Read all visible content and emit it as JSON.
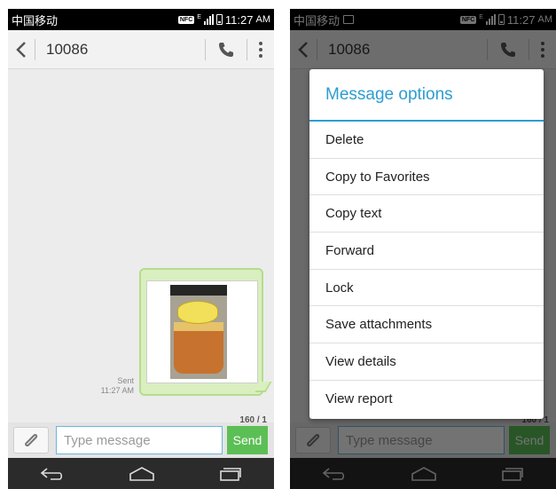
{
  "status": {
    "carrier": "中国移动",
    "nfc": "NFC",
    "network": "E",
    "time": "11:27",
    "ampm": "AM"
  },
  "header": {
    "contact": "10086"
  },
  "message": {
    "status": "Sent",
    "time": "11:27 AM"
  },
  "composer": {
    "counter": "160 / 1",
    "placeholder": "Type message",
    "send": "Send"
  },
  "dialog": {
    "title": "Message options",
    "options": [
      "Delete",
      "Copy to Favorites",
      "Copy text",
      "Forward",
      "Lock",
      "Save attachments",
      "View details",
      "View report"
    ]
  },
  "colors": {
    "accent": "#2d9dd1",
    "send": "#5bbf55",
    "bubble": "#d9efbf"
  }
}
